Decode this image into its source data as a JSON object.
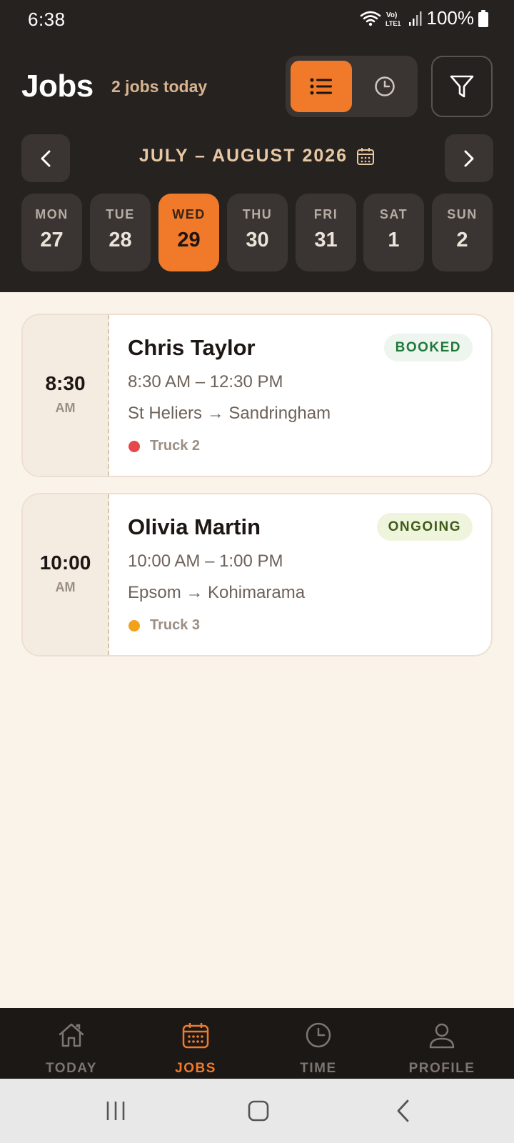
{
  "status_bar": {
    "time": "6:38",
    "network": "Vo) LTE1",
    "battery": "100%"
  },
  "header": {
    "title": "Jobs",
    "subtitle": "2 jobs today",
    "view_toggle": {
      "active": "list",
      "options": [
        "list-icon",
        "clock-icon"
      ]
    },
    "filter_icon": "filter-icon"
  },
  "calendar": {
    "month_label": "JULY – AUGUST 2026",
    "days": [
      {
        "name": "MON",
        "num": "27",
        "selected": false
      },
      {
        "name": "TUE",
        "num": "28",
        "selected": false
      },
      {
        "name": "WED",
        "num": "29",
        "selected": true
      },
      {
        "name": "THU",
        "num": "30",
        "selected": false
      },
      {
        "name": "FRI",
        "num": "31",
        "selected": false
      },
      {
        "name": "SAT",
        "num": "1",
        "selected": false
      },
      {
        "name": "SUN",
        "num": "2",
        "selected": false
      }
    ]
  },
  "jobs": [
    {
      "time": "8:30",
      "ampm": "AM",
      "name": "Chris Taylor",
      "status": "BOOKED",
      "status_color": "#1f7a3a",
      "status_bg": "#eef4ee",
      "hours": "8:30 AM – 12:30 PM",
      "route": "St Heliers → Sandringham",
      "truck": "Truck 2",
      "truck_color": "#e5484d"
    },
    {
      "time": "10:00",
      "ampm": "AM",
      "name": "Olivia Martin",
      "status": "ONGOING",
      "status_color": "#3f5a1a",
      "status_bg": "#eef5dc",
      "hours": "10:00 AM – 1:00 PM",
      "route": "Epsom → Kohimarama",
      "truck": "Truck 3",
      "truck_color": "#f3a11a"
    }
  ],
  "bottom_nav": {
    "items": [
      {
        "label": "TODAY",
        "icon": "home-icon",
        "active": false
      },
      {
        "label": "JOBS",
        "icon": "calendar-icon",
        "active": true
      },
      {
        "label": "TIME",
        "icon": "clock-icon",
        "active": false
      },
      {
        "label": "PROFILE",
        "icon": "user-icon",
        "active": false
      }
    ]
  },
  "colors": {
    "accent": "#f07a2a",
    "header_bg": "#262220",
    "page_bg": "#faf3ea"
  }
}
